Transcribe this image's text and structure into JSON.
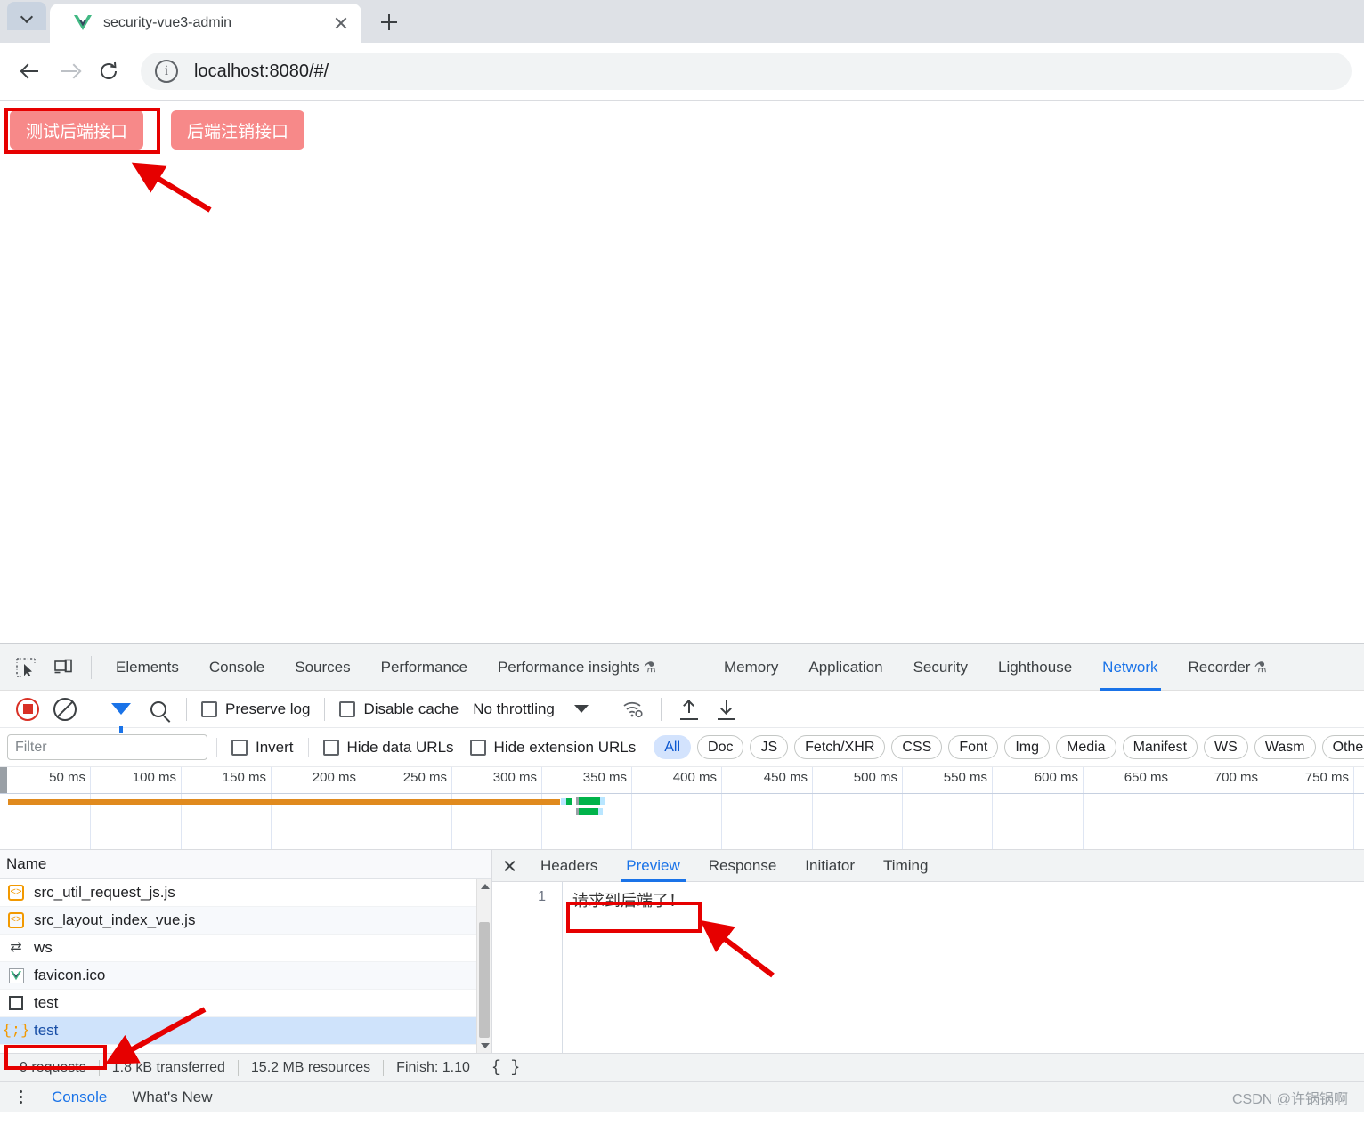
{
  "browser": {
    "tab": {
      "title": "security-vue3-admin",
      "favicon": "vue-logo-icon"
    },
    "tab_list_icon": "chevron-down-icon",
    "close_icon": "close-icon",
    "new_tab_icon": "plus-icon",
    "back_icon": "arrow-left-icon",
    "forward_icon": "arrow-right-icon",
    "reload_icon": "reload-icon",
    "site_info_icon": "info-circle-icon",
    "url": "localhost:8080/#/"
  },
  "page": {
    "buttons": [
      {
        "label": "测试后端接口",
        "name": "test-backend-api-button"
      },
      {
        "label": "后端注销接口",
        "name": "backend-logout-api-button"
      }
    ]
  },
  "devtools": {
    "inspect_icon": "inspect-element-icon",
    "device_icon": "device-toolbar-icon",
    "tabs": [
      {
        "label": "Elements",
        "active": false
      },
      {
        "label": "Console",
        "active": false
      },
      {
        "label": "Sources",
        "active": false
      },
      {
        "label": "Performance",
        "active": false
      },
      {
        "label": "Performance insights",
        "active": false,
        "flask": "⚗"
      },
      {
        "label": "Memory",
        "active": false
      },
      {
        "label": "Application",
        "active": false
      },
      {
        "label": "Security",
        "active": false
      },
      {
        "label": "Lighthouse",
        "active": false
      },
      {
        "label": "Network",
        "active": true
      },
      {
        "label": "Recorder",
        "active": false,
        "flask": "⚗"
      }
    ],
    "network_toolbar": {
      "record_icon": "record-stop-icon",
      "clear_icon": "clear-network-log-icon",
      "filter_icon": "filter-funnel-icon",
      "search_icon": "search-icon",
      "preserve_log": {
        "label": "Preserve log",
        "checked": false
      },
      "disable_cache": {
        "label": "Disable cache",
        "checked": false
      },
      "throttling": "No throttling",
      "throttle_caret": "caret-down-icon",
      "network_conditions_icon": "wifi-settings-icon",
      "import_har_icon": "upload-har-icon",
      "export_har_icon": "download-har-icon"
    },
    "filter_bar": {
      "filter_placeholder": "Filter",
      "filter_value": "",
      "invert": {
        "label": "Invert",
        "checked": false
      },
      "hide_data_urls": {
        "label": "Hide data URLs",
        "checked": false
      },
      "hide_extension_urls": {
        "label": "Hide extension URLs",
        "checked": false
      },
      "types": [
        {
          "label": "All",
          "selected": true
        },
        {
          "label": "Doc",
          "selected": false
        },
        {
          "label": "JS",
          "selected": false
        },
        {
          "label": "Fetch/XHR",
          "selected": false
        },
        {
          "label": "CSS",
          "selected": false
        },
        {
          "label": "Font",
          "selected": false
        },
        {
          "label": "Img",
          "selected": false
        },
        {
          "label": "Media",
          "selected": false
        },
        {
          "label": "Manifest",
          "selected": false
        },
        {
          "label": "WS",
          "selected": false
        },
        {
          "label": "Wasm",
          "selected": false
        },
        {
          "label": "Other",
          "selected": false
        }
      ]
    },
    "overview": {
      "ticks": [
        "50 ms",
        "100 ms",
        "150 ms",
        "200 ms",
        "250 ms",
        "300 ms",
        "350 ms",
        "400 ms",
        "450 ms",
        "500 ms",
        "550 ms",
        "600 ms",
        "650 ms",
        "700 ms",
        "750 ms"
      ]
    },
    "requests": {
      "column_header": "Name",
      "rows": [
        {
          "name": "src_util_request_js.js",
          "icon": "js-file-icon",
          "selected": false
        },
        {
          "name": "src_layout_index_vue.js",
          "icon": "js-file-icon",
          "selected": false
        },
        {
          "name": "ws",
          "icon": "websocket-icon",
          "selected": false
        },
        {
          "name": "favicon.ico",
          "icon": "vue-favicon-icon",
          "selected": false
        },
        {
          "name": "test",
          "icon": "document-icon",
          "selected": false
        },
        {
          "name": "test",
          "icon": "json-icon",
          "selected": true
        }
      ],
      "scroll_up_icon": "scroll-up-arrow-icon",
      "scroll_down_icon": "scroll-down-arrow-icon"
    },
    "detail": {
      "close_icon": "close-icon",
      "tabs": [
        {
          "label": "Headers",
          "active": false
        },
        {
          "label": "Preview",
          "active": true
        },
        {
          "label": "Response",
          "active": false
        },
        {
          "label": "Initiator",
          "active": false
        },
        {
          "label": "Timing",
          "active": false
        }
      ],
      "preview": {
        "line_number": "1",
        "content": "请求到后端了！"
      }
    },
    "status_bar": {
      "requests": "9 requests",
      "transferred": "1.8 kB transferred",
      "resources": "15.2 MB resources",
      "finish": "Finish: 1.10",
      "format_icon": "pretty-print-braces-icon"
    },
    "drawer": {
      "more_icon": "more-options-kebab-icon",
      "tabs": [
        {
          "label": "Console",
          "active": true
        },
        {
          "label": "What's New",
          "active": false
        }
      ]
    }
  },
  "watermark": "CSDN @许锅锅啊",
  "colors": {
    "accent_blue": "#1a73e8",
    "button_red": "#f78989",
    "annotation_red": "#e60000",
    "timeline_orange": "#e08a1e",
    "timeline_green": "#00b34a"
  }
}
